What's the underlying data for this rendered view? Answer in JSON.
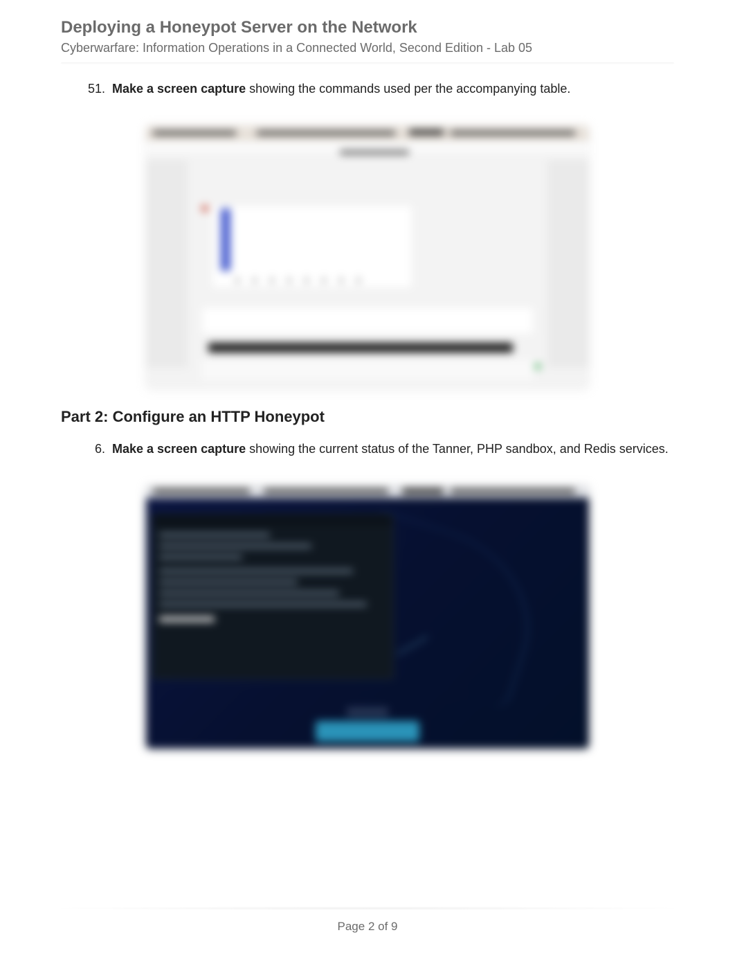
{
  "header": {
    "title": "Deploying a Honeypot Server on the Network",
    "subtitle": "Cyberwarfare: Information Operations in a Connected World, Second Edition - Lab 05"
  },
  "item1": {
    "number": "51.",
    "bold": "Make a screen capture",
    "rest": " showing the commands used per the accompanying table."
  },
  "section_title": "Part 2: Configure an HTTP Honeypot",
  "item2": {
    "number": "6.",
    "bold": "Make a screen capture",
    "rest": " showing the current status of the Tanner, PHP sandbox, and Redis services."
  },
  "footer": "Page 2 of 9"
}
